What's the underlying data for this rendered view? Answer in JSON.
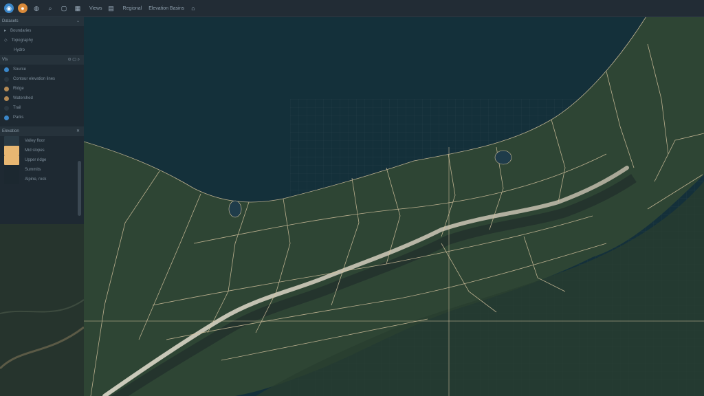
{
  "toolbar": {
    "menu_view": "Views",
    "menu_region": "Regional",
    "menu_basemap": "Elevation Basins"
  },
  "sidebar": {
    "section_title": "Datasets",
    "dataset_items": [
      "Boundaries",
      "Topography",
      "Hydro"
    ],
    "filter_label": "Vis",
    "layers": [
      "Source",
      "Contour elevation lines",
      "Ridge",
      "Watershed",
      "Trail",
      "Parks"
    ],
    "legend_title": "Elevation",
    "legend_items": [
      "Valley floor",
      "Mid slopes",
      "Upper ridge",
      "Summits",
      "Alpine, rock"
    ]
  },
  "colors": {
    "accent": "#3a86c8",
    "orange": "#d98a3a",
    "boundary": "#d9c7a1",
    "water": "#0f2a35",
    "forest": "#2f4a3a"
  },
  "icons": [
    "app-icon",
    "layers-icon",
    "globe-icon",
    "search-icon",
    "rectangle-icon",
    "grid-icon",
    "document-icon",
    "lock-icon"
  ]
}
